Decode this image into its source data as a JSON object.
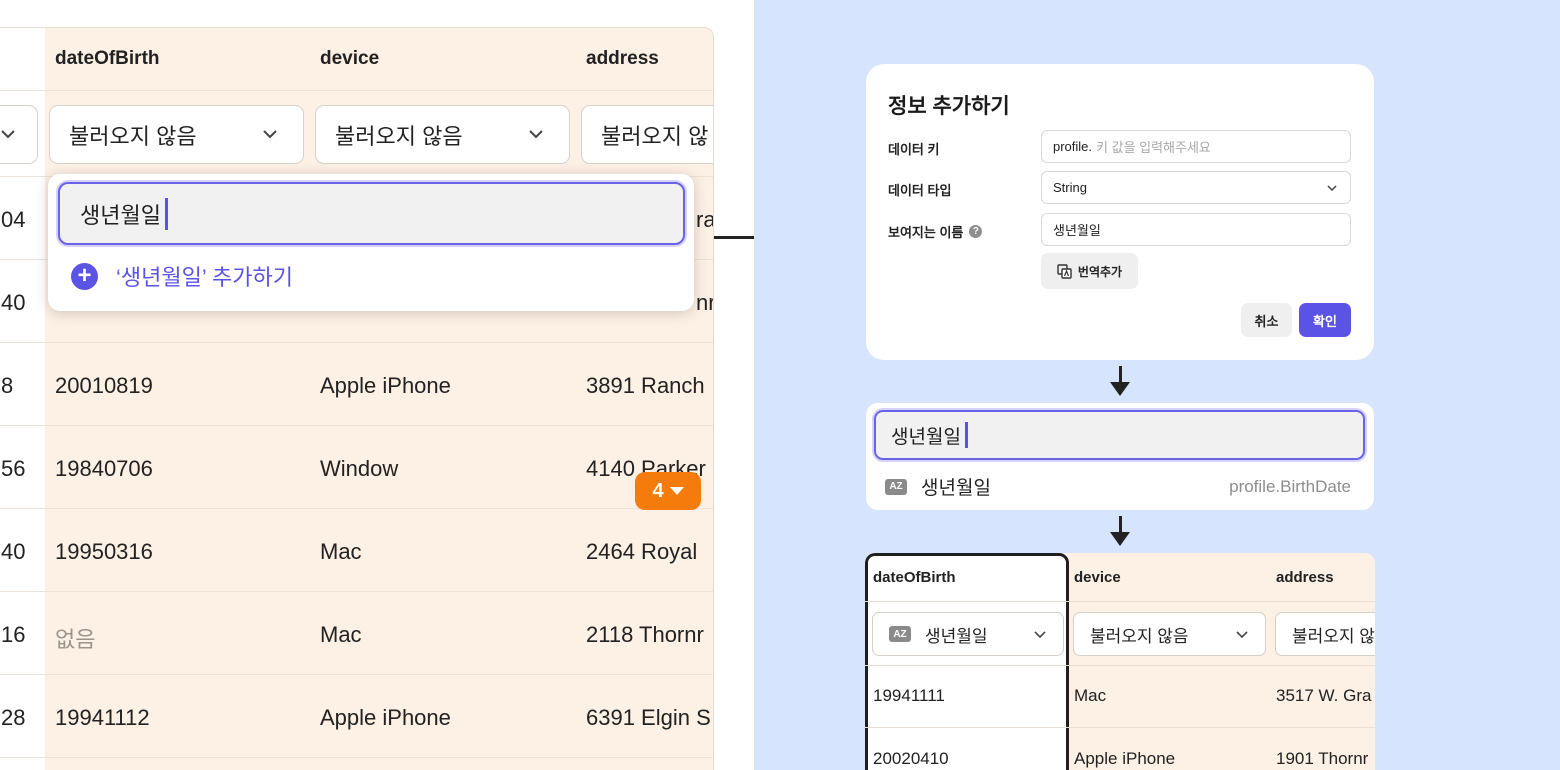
{
  "table": {
    "columns": [
      "dateOfBirth",
      "device",
      "address"
    ],
    "select_value": "불러오지 않음",
    "partial_select_value": "불러오지 않",
    "rows": [
      {
        "left": "04",
        "dob": "",
        "device": "",
        "address": "ra"
      },
      {
        "left": "40",
        "dob": "",
        "device": "",
        "address": "nr"
      },
      {
        "left": "8",
        "dob": "20010819",
        "device": "Apple iPhone",
        "address": "3891 Ranch"
      },
      {
        "left": "56",
        "dob": "19840706",
        "device": "Window",
        "address": "4140 Parker"
      },
      {
        "left": "40",
        "dob": "19950316",
        "device": "Mac",
        "address": "2464 Royal"
      },
      {
        "left": "16",
        "dob": "없음",
        "device": "Mac",
        "address": "2118 Thornr"
      },
      {
        "left": "28",
        "dob": "19941112",
        "device": "Apple iPhone",
        "address": "6391 Elgin S"
      }
    ]
  },
  "dropdown": {
    "input_value": "생년월일",
    "add_label": "‘생년월일’ 추가하기"
  },
  "badge": {
    "count": "4"
  },
  "modal": {
    "title": "정보 추가하기",
    "key_label": "데이터 키",
    "key_prefix": "profile.",
    "key_placeholder": "키 값을 입력해주세요",
    "type_label": "데이터 타입",
    "type_value": "String",
    "name_label": "보여지는 이름",
    "name_value": "생년월일",
    "translate_label": "번역추가",
    "cancel_label": "취소",
    "ok_label": "확인"
  },
  "search": {
    "input_value": "생년월일",
    "option_label": "생년월일",
    "option_key": "profile.BirthDate",
    "az": "AZ"
  },
  "mini_table": {
    "columns": [
      "dateOfBirth",
      "device",
      "address"
    ],
    "first_select": "생년월일",
    "select_value": "불러오지 않음",
    "partial_select_value": "불러오지 않",
    "rows": [
      {
        "dob": "19941111",
        "device": "Mac",
        "address": "3517 W. Gra"
      },
      {
        "dob": "20020410",
        "device": "Apple iPhone",
        "address": "1901 Thornr"
      }
    ]
  },
  "colors": {
    "accent": "#5b52e6",
    "badge": "#f57c0c",
    "highlight": "#fdf0e4",
    "background": "#d7e4fd"
  }
}
